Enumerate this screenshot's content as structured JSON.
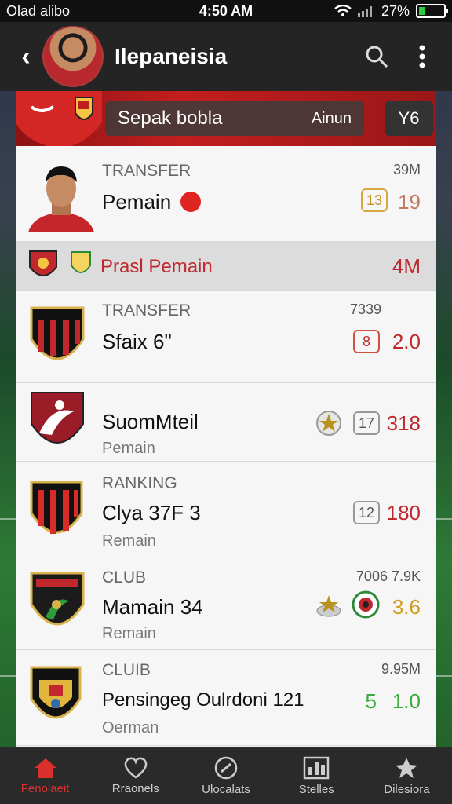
{
  "status_bar": {
    "carrier": "Olad alibo",
    "time": "4:50 AM",
    "battery": "27%",
    "battery_level": 0.27
  },
  "app_bar": {
    "title": "Ilepaneisia",
    "search_icon": "search-icon",
    "more_icon": "more-vert-icon"
  },
  "banner": {
    "search_label": "Sepak bobla",
    "search_action": "Ainun",
    "badge": "Y6"
  },
  "rows": [
    {
      "label": "TRANSFER",
      "title": "Pemain",
      "meta": "39M",
      "badge": "13",
      "stat": "19"
    },
    {
      "title": "Prasl Pemain",
      "stat": "4M"
    },
    {
      "label": "TRANSFER",
      "title": "Sfaix 6\"",
      "meta": "7339",
      "badge": "8",
      "stat": "2.0"
    },
    {
      "title": "SuomMteil",
      "sub": "Pemain",
      "badge": "17",
      "stat": "318"
    },
    {
      "label": "RANKING",
      "title": "Clya 37F 3",
      "sub": "Remain",
      "badge": "12",
      "stat": "180"
    },
    {
      "label": "CLUB",
      "title": "Mamain 34",
      "sub": "Remain",
      "meta": "7006  7.9K",
      "stat": "3.6"
    },
    {
      "label": "CLUIB",
      "title": "Pensingeg Oulrdoni 121",
      "sub": "Oerman",
      "meta": "9.95M",
      "stat_prefix": "5",
      "stat": "1.0"
    }
  ],
  "nav": [
    {
      "label": "Fenolaeit",
      "icon": "home-icon",
      "active": true
    },
    {
      "label": "Rraonels",
      "icon": "heart-icon",
      "active": false
    },
    {
      "label": "Ulocalats",
      "icon": "ball-icon",
      "active": false
    },
    {
      "label": "Stelles",
      "icon": "stats-icon",
      "active": false
    },
    {
      "label": "Dilesiora",
      "icon": "star-icon",
      "active": false
    }
  ],
  "colors": {
    "accent": "#c0282d",
    "appbar": "#242424",
    "nav_active": "#d9302d"
  }
}
